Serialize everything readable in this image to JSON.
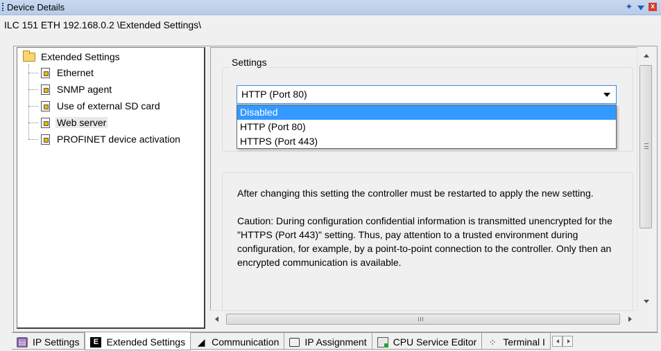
{
  "window": {
    "title": "Device Details",
    "icons": [
      "pin-icon",
      "dropdown-icon",
      "close-icon"
    ]
  },
  "path": "ILC 151 ETH 192.168.0.2 \\Extended Settings\\",
  "tree": {
    "root": "Extended Settings",
    "items": [
      {
        "label": "Ethernet"
      },
      {
        "label": "SNMP agent"
      },
      {
        "label": "Use of external SD card"
      },
      {
        "label": "Web server",
        "selected": true
      },
      {
        "label": "PROFINET device activation"
      }
    ]
  },
  "settings": {
    "group_label": "Settings",
    "selected_value": "HTTP (Port 80)",
    "options": [
      "Disabled",
      "HTTP (Port 80)",
      "HTTPS (Port 443)"
    ],
    "highlighted_option": "Disabled"
  },
  "info": {
    "paragraph1": "After changing this setting the controller must be restarted to apply the new setting.",
    "paragraph2": "Caution: During configuration confidential information is transmitted unencrypted for the \"HTTPS (Port 443)\" setting. Thus, pay attention to a trusted environment during configuration, for example, by a point-to-point connection to the controller. Only then an encrypted communication is available."
  },
  "tabs": [
    {
      "label": "IP Settings",
      "icon": "ip-settings-icon"
    },
    {
      "label": "Extended Settings",
      "icon": "extended-settings-icon",
      "active": true
    },
    {
      "label": "Communication",
      "icon": "communication-icon"
    },
    {
      "label": "IP Assignment",
      "icon": "ip-assignment-icon"
    },
    {
      "label": "CPU Service Editor",
      "icon": "cpu-service-icon"
    },
    {
      "label": "Terminal I",
      "icon": "terminal-icon"
    }
  ],
  "colors": {
    "selection": "#3399ff",
    "titlebar": "#c9d8ee",
    "combo_border": "#3a88d5"
  }
}
